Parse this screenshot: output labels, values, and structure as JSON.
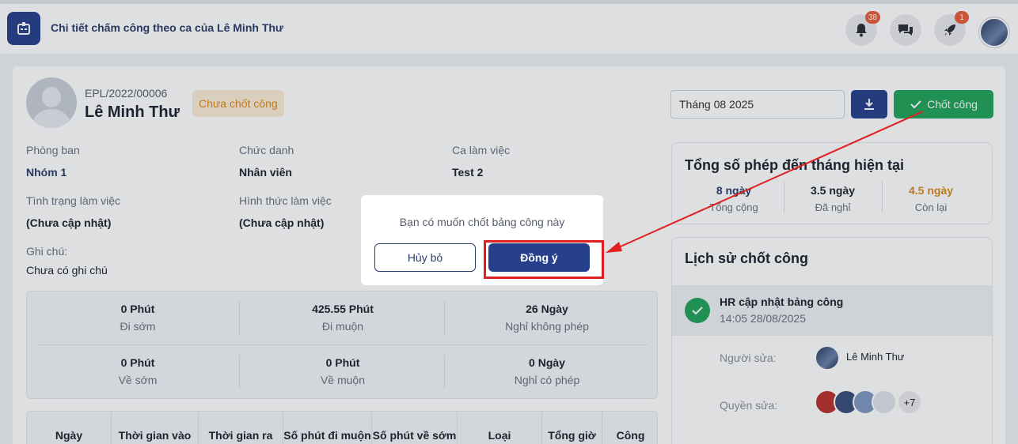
{
  "header": {
    "title": "Chi tiết chấm công theo ca của Lê Minh Thư",
    "notifications_count": "38",
    "rocket_count": "1"
  },
  "employee": {
    "code": "EPL/2022/00006",
    "name": "Lê Minh Thư",
    "status": "Chưa chốt công"
  },
  "controls": {
    "month": "Tháng 08 2025",
    "lock_label": "Chốt công"
  },
  "info": {
    "department_label": "Phòng ban",
    "department_value": "Nhóm 1",
    "position_label": "Chức danh",
    "position_value": "Nhân viên",
    "shift_label": "Ca làm việc",
    "shift_value": "Test 2",
    "work_status_label": "Tình trạng làm việc",
    "work_status_value": "(Chưa cập nhật)",
    "work_type_label": "Hình thức làm việc",
    "work_type_value": "(Chưa cập nhật)",
    "note_label": "Ghi chú:",
    "note_value": "Chưa có ghi chú"
  },
  "stats": [
    {
      "value": "0 Phút",
      "label": "Đi sớm"
    },
    {
      "value": "425.55 Phút",
      "label": "Đi muộn"
    },
    {
      "value": "26 Ngày",
      "label": "Nghỉ không phép"
    },
    {
      "value": "0 Phút",
      "label": "Về sớm"
    },
    {
      "value": "0 Phút",
      "label": "Về muộn"
    },
    {
      "value": "0 Ngày",
      "label": "Nghỉ có phép"
    }
  ],
  "table": {
    "columns": [
      "Ngày",
      "Thời gian vào",
      "Thời gian ra",
      "Số phút đi muộn",
      "Số phút về sớm",
      "Loại",
      "Tổng giờ",
      "Công"
    ]
  },
  "leave": {
    "title": "Tổng số phép đến tháng hiện tại",
    "total_value": "8 ngày",
    "total_label": "Tổng cộng",
    "used_value": "3.5 ngày",
    "used_label": "Đã nghỉ",
    "remaining_value": "4.5 ngày",
    "remaining_label": "Còn lại"
  },
  "history": {
    "title": "Lịch sử chốt công",
    "event": "HR cập nhật bảng công",
    "time": "14:05 28/08/2025",
    "editor_label": "Người sửa:",
    "editor_name": "Lê Minh Thư",
    "permission_label": "Quyền sửa:",
    "more_count": "+7"
  },
  "dialog": {
    "message": "Bạn có muốn chốt bảng công này",
    "cancel_label": "Hủy bỏ",
    "confirm_label": "Đồng ý"
  },
  "colors": {
    "primary": "#27408b",
    "success": "#22a35a",
    "warning": "#d98a1c",
    "annotation": "#e02020"
  }
}
